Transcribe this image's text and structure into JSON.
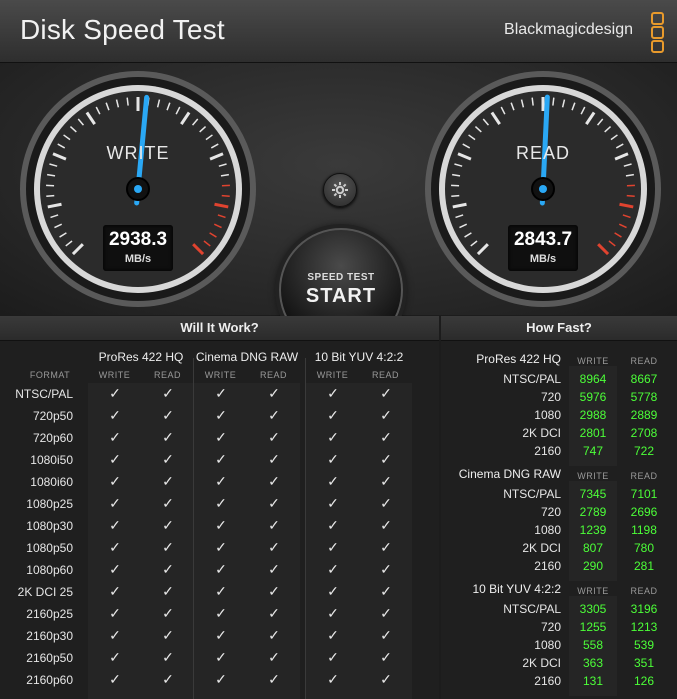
{
  "header": {
    "title": "Disk Speed Test",
    "brand": "Blackmagicdesign"
  },
  "colors": {
    "accent_needle": "#2aa8f5",
    "value_green": "#4cff38",
    "redline": "#e0432f",
    "brand_orange": "#e89a2c"
  },
  "gauges": {
    "write": {
      "label": "WRITE",
      "value": "2938.3",
      "unit": "MB/s",
      "level_fraction": 0.52
    },
    "read": {
      "label": "READ",
      "value": "2843.7",
      "unit": "MB/s",
      "level_fraction": 0.51
    }
  },
  "controls": {
    "settings_icon": "gear-icon",
    "start_sub": "SPEED TEST",
    "start_main": "START"
  },
  "will_it_work": {
    "title": "Will It Work?",
    "format_label": "FORMAT",
    "codecs": [
      "ProRes 422 HQ",
      "Cinema DNG RAW",
      "10 Bit YUV 4:2:2"
    ],
    "write_label": "WRITE",
    "read_label": "READ",
    "check_glyph": "✓",
    "formats": [
      "NTSC/PAL",
      "720p50",
      "720p60",
      "1080i50",
      "1080i60",
      "1080p25",
      "1080p30",
      "1080p50",
      "1080p60",
      "2K DCI 25",
      "2160p25",
      "2160p30",
      "2160p50",
      "2160p60"
    ]
  },
  "how_fast": {
    "title": "How Fast?",
    "write_label": "WRITE",
    "read_label": "READ",
    "groups": [
      {
        "codec": "ProRes 422 HQ",
        "rows": [
          {
            "label": "NTSC/PAL",
            "write": "8964",
            "read": "8667"
          },
          {
            "label": "720",
            "write": "5976",
            "read": "5778"
          },
          {
            "label": "1080",
            "write": "2988",
            "read": "2889"
          },
          {
            "label": "2K DCI",
            "write": "2801",
            "read": "2708"
          },
          {
            "label": "2160",
            "write": "747",
            "read": "722"
          }
        ]
      },
      {
        "codec": "Cinema DNG RAW",
        "rows": [
          {
            "label": "NTSC/PAL",
            "write": "7345",
            "read": "7101"
          },
          {
            "label": "720",
            "write": "2789",
            "read": "2696"
          },
          {
            "label": "1080",
            "write": "1239",
            "read": "1198"
          },
          {
            "label": "2K DCI",
            "write": "807",
            "read": "780"
          },
          {
            "label": "2160",
            "write": "290",
            "read": "281"
          }
        ]
      },
      {
        "codec": "10 Bit YUV 4:2:2",
        "rows": [
          {
            "label": "NTSC/PAL",
            "write": "3305",
            "read": "3196"
          },
          {
            "label": "720",
            "write": "1255",
            "read": "1213"
          },
          {
            "label": "1080",
            "write": "558",
            "read": "539"
          },
          {
            "label": "2K DCI",
            "write": "363",
            "read": "351"
          },
          {
            "label": "2160",
            "write": "131",
            "read": "126"
          }
        ]
      }
    ]
  }
}
